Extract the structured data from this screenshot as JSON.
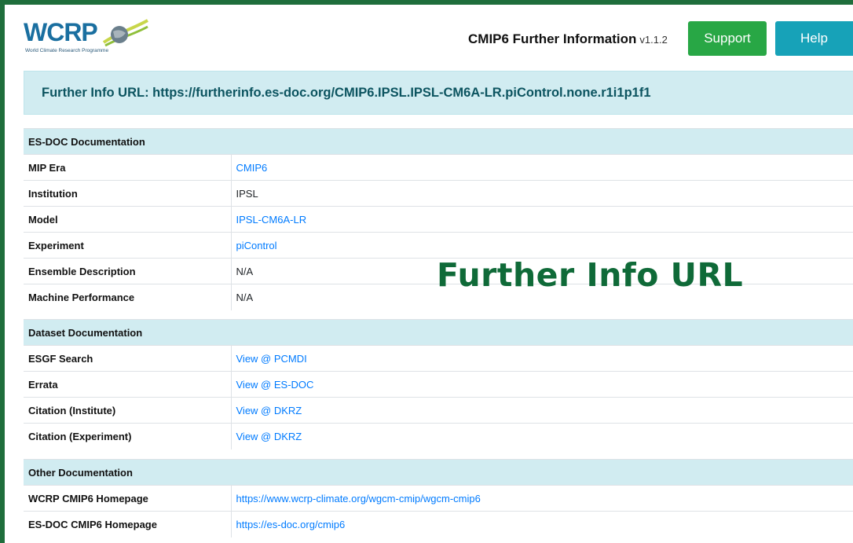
{
  "logo": {
    "text": "WCRP",
    "subtitle": "World Climate Research Programme",
    "brand_color": "#1a6fa0"
  },
  "header": {
    "title": "CMIP6 Further Information",
    "version": "v1.1.2"
  },
  "buttons": {
    "support": "Support",
    "help": "Help"
  },
  "banner": {
    "text": "Further Info URL: https://furtherinfo.es-doc.org/CMIP6.IPSL.IPSL-CM6A-LR.piControl.none.r1i1p1f1"
  },
  "overlay_text": "Further Info URL",
  "es_doc": {
    "heading": "ES-DOC Documentation",
    "rows": [
      {
        "label": "MIP Era",
        "value": "CMIP6"
      },
      {
        "label": "Institution",
        "value": "IPSL"
      },
      {
        "label": "Model",
        "value": "IPSL-CM6A-LR"
      },
      {
        "label": "Experiment",
        "value": "piControl"
      },
      {
        "label": "Ensemble Description",
        "value": "N/A"
      },
      {
        "label": "Machine Performance",
        "value": "N/A"
      }
    ]
  },
  "dataset_doc": {
    "heading": "Dataset Documentation",
    "rows": [
      {
        "label": "ESGF Search",
        "value": "View @ PCMDI"
      },
      {
        "label": "Errata",
        "value": "View @ ES-DOC"
      },
      {
        "label": "Citation (Institute)",
        "value": "View @ DKRZ"
      },
      {
        "label": "Citation (Experiment)",
        "value": "View @ DKRZ"
      }
    ]
  },
  "other_doc": {
    "heading": "Other Documentation",
    "rows": [
      {
        "label": "WCRP CMIP6 Homepage",
        "value": "https://www.wcrp-climate.org/wgcm-cmip/wgcm-cmip6"
      },
      {
        "label": "ES-DOC CMIP6 Homepage",
        "value": "https://es-doc.org/cmip6"
      }
    ]
  },
  "colors": {
    "frame": "#1f6e3c",
    "section_bg": "#d1ecf1",
    "link": "#007bff",
    "support": "#28a745",
    "help": "#17a2b8"
  }
}
